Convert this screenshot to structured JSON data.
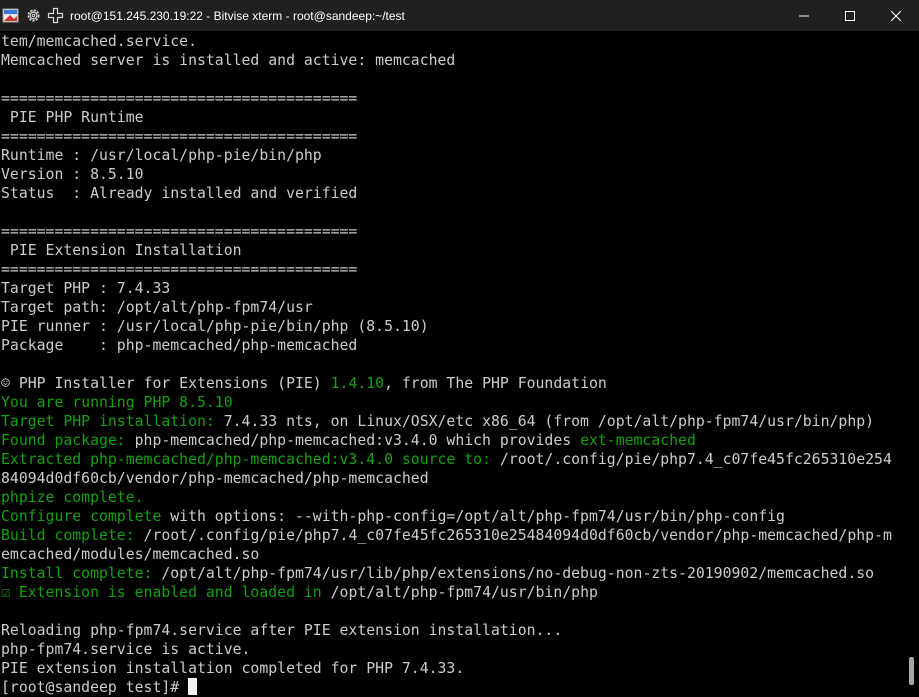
{
  "window": {
    "title": "root@151.245.230.19:22 - Bitvise xterm - root@sandeep:~/test",
    "icons": [
      "bitvise-app-icon",
      "gear-icon",
      "new-window-icon"
    ],
    "controls": [
      "minimize-icon",
      "maximize-icon",
      "close-icon"
    ]
  },
  "colors": {
    "background": "#000000",
    "foreground": "#cccccc",
    "success_green": "#13a10e",
    "titlebar": "#202020"
  },
  "terminal": {
    "lines": [
      [
        {
          "t": "tem/memcached.service."
        }
      ],
      [
        {
          "t": "Memcached server is installed and active: memcached"
        }
      ],
      [
        {
          "t": ""
        }
      ],
      [
        {
          "t": "========================================"
        }
      ],
      [
        {
          "t": " PIE PHP Runtime"
        }
      ],
      [
        {
          "t": "========================================"
        }
      ],
      [
        {
          "t": "Runtime : /usr/local/php-pie/bin/php"
        }
      ],
      [
        {
          "t": "Version : 8.5.10"
        }
      ],
      [
        {
          "t": "Status  : Already installed and verified"
        }
      ],
      [
        {
          "t": ""
        }
      ],
      [
        {
          "t": "========================================"
        }
      ],
      [
        {
          "t": " PIE Extension Installation"
        }
      ],
      [
        {
          "t": "========================================"
        }
      ],
      [
        {
          "t": "Target PHP : 7.4.33"
        }
      ],
      [
        {
          "t": "Target path: /opt/alt/php-fpm74/usr"
        }
      ],
      [
        {
          "t": "PIE runner : /usr/local/php-pie/bin/php (8.5.10)"
        }
      ],
      [
        {
          "t": "Package    : php-memcached/php-memcached"
        }
      ],
      [
        {
          "t": ""
        }
      ],
      [
        {
          "t": "☺ PHP Installer for Extensions (PIE) "
        },
        {
          "t": "1.4.10",
          "c": "g"
        },
        {
          "t": ", from The PHP Foundation"
        }
      ],
      [
        {
          "t": "You are running PHP 8.5.10",
          "c": "g"
        }
      ],
      [
        {
          "t": "Target PHP installation:",
          "c": "g"
        },
        {
          "t": " 7.4.33 nts, on Linux/OSX/etc x86_64 (from /opt/alt/php-fpm74/usr/bin/php)"
        }
      ],
      [
        {
          "t": "Found package:",
          "c": "g"
        },
        {
          "t": " php-memcached/php-memcached:v3.4.0 which provides "
        },
        {
          "t": "ext-memcached",
          "c": "g"
        }
      ],
      [
        {
          "t": "Extracted php-memcached/php-memcached:v3.4.0 source to:",
          "c": "g"
        },
        {
          "t": " /root/.config/pie/php7.4_c07fe45fc265310e254"
        }
      ],
      [
        {
          "t": "84094d0df60cb/vendor/php-memcached/php-memcached"
        }
      ],
      [
        {
          "t": "phpize complete.",
          "c": "g"
        }
      ],
      [
        {
          "t": "Configure complete",
          "c": "g"
        },
        {
          "t": " with options: --with-php-config=/opt/alt/php-fpm74/usr/bin/php-config"
        }
      ],
      [
        {
          "t": "Build complete:",
          "c": "g"
        },
        {
          "t": " /root/.config/pie/php7.4_c07fe45fc265310e25484094d0df60cb/vendor/php-memcached/php-m"
        }
      ],
      [
        {
          "t": "emcached/modules/memcached.so"
        }
      ],
      [
        {
          "t": "Install complete:",
          "c": "g"
        },
        {
          "t": " /opt/alt/php-fpm74/usr/lib/php/extensions/no-debug-non-zts-20190902/memcached.so"
        }
      ],
      [
        {
          "t": "☑ Extension is enabled and loaded in",
          "c": "g"
        },
        {
          "t": " /opt/alt/php-fpm74/usr/bin/php"
        }
      ],
      [
        {
          "t": ""
        }
      ],
      [
        {
          "t": "Reloading php-fpm74.service after PIE extension installation..."
        }
      ],
      [
        {
          "t": "php-fpm74.service is active."
        }
      ],
      [
        {
          "t": "PIE extension installation completed for PHP 7.4.33."
        }
      ]
    ],
    "prompt": "[root@sandeep test]# "
  }
}
